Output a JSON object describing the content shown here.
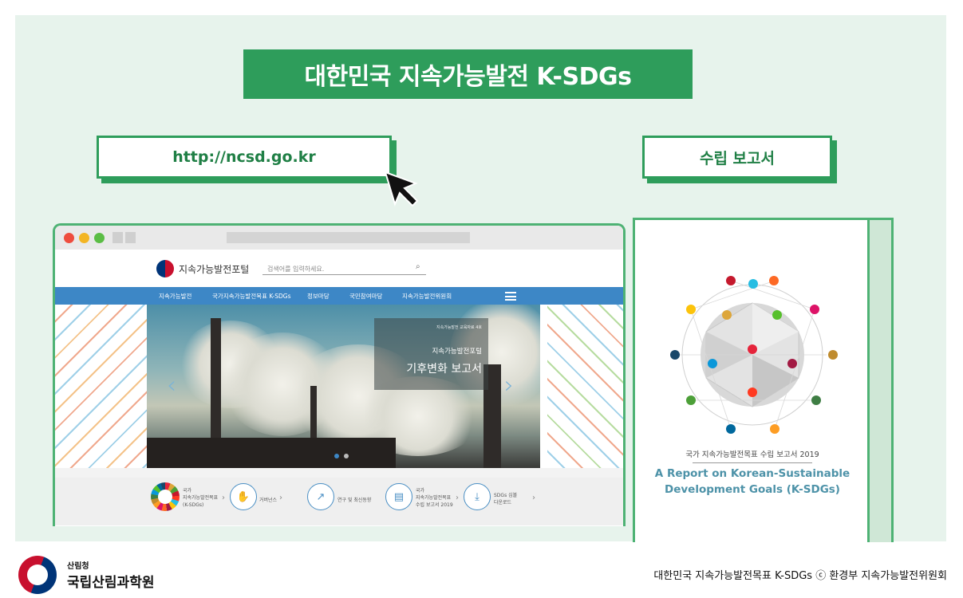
{
  "title": "대한민국 지속가능발전 K-SDGs",
  "url_box": "http://ncsd.go.kr",
  "report_box": "수립 보고서",
  "browser": {
    "site_name": "지속가능발전포털",
    "search_placeholder": "검색어를 입력하세요.",
    "nav": [
      "지속가능발전",
      "국가지속가능발전목표 K-SDGs",
      "정보마당",
      "국민참여마당",
      "지속가능발전위원회"
    ],
    "hero": {
      "small": "지속가능발전 교육자료 4호",
      "subtitle": "지속가능발전포털",
      "title": "기후변화 보고서"
    },
    "bottom": [
      {
        "lines": [
          "국가",
          "지속가능발전목표",
          "(K-SDGs)"
        ]
      },
      {
        "lines": [
          "거버넌스"
        ]
      },
      {
        "lines": [
          "연구 및 최신동향"
        ]
      },
      {
        "lines": [
          "국가",
          "지속가능발전목표",
          "수립 보고서 2019"
        ]
      },
      {
        "lines": [
          "SDGs 심볼",
          "다운로드"
        ]
      }
    ]
  },
  "report": {
    "small": "국가 지속가능발전목표 수립 보고서 2019",
    "title_line1": "A Report on Korean-Sustainable",
    "title_line2": "Development Goals (K-SDGs)"
  },
  "footer": {
    "org_small": "산림청",
    "org_name": "국립산림과학원",
    "credit": "대한민국 지속가능발전목표 K-SDGs  ⓒ 환경부 지속가능발전위원회"
  },
  "colors": {
    "accent": "#2e9d5b",
    "nav": "#3d87c6",
    "background": "#e7f3ec"
  }
}
